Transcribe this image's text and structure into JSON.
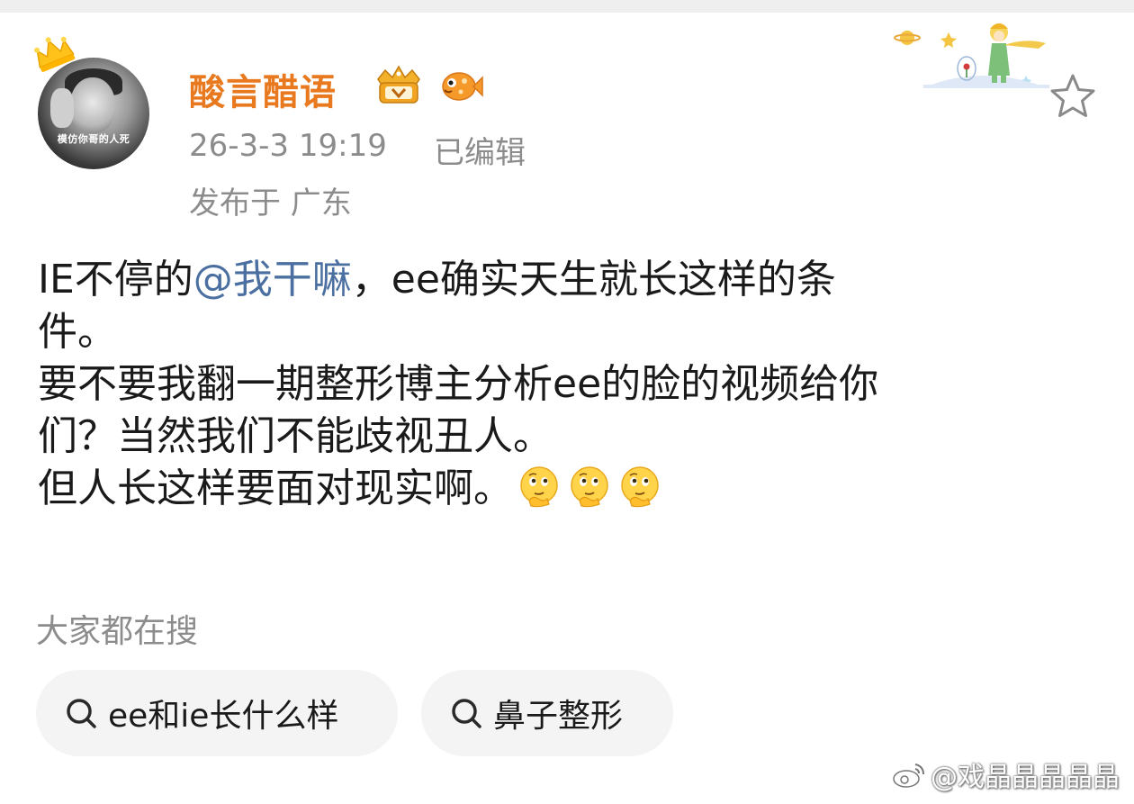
{
  "post": {
    "username": "酸言醋语",
    "avatar_caption": "模仿你哥的人死",
    "timestamp": "26-3-3 19:19",
    "edited": "已编辑",
    "location": "发布于 广东",
    "content": {
      "line1_prefix": "IE不停的",
      "mention": "@我干嘛",
      "line1_suffix": "，ee确实天生就长这样的条",
      "line2": "件。",
      "line3": "要不要我翻一期整形博主分析ee的脸的视频给你",
      "line4": "们？当然我们不能歧视丑人。",
      "line5": "但人长这样要面对现实啊。"
    }
  },
  "search": {
    "title": "大家都在搜",
    "suggestions": [
      {
        "label": "ee和ie长什么样"
      },
      {
        "label": "鼻子整形"
      }
    ]
  },
  "watermark": {
    "text": "@戏晶晶晶晶晶"
  },
  "colors": {
    "username": "#e8791e",
    "mention": "#4a6fa0",
    "meta": "#8c8c8c",
    "pill_bg": "#f4f4f4"
  }
}
